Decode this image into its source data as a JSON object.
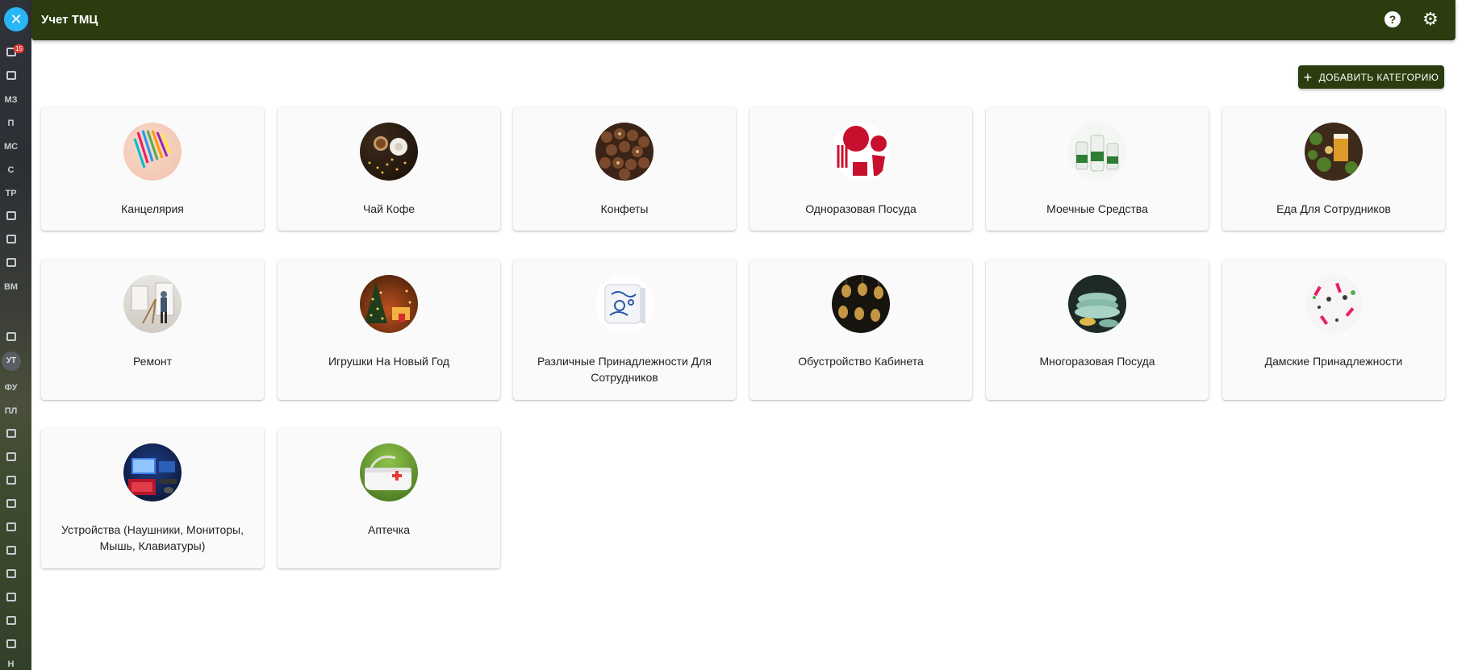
{
  "header": {
    "title": "Учет ТМЦ",
    "help_icon": "?",
    "settings_icon": "⚙"
  },
  "rail": {
    "close_icon": "✕",
    "badge_count": "15",
    "labels": [
      "МЗ",
      "П",
      "МС",
      "С",
      "ТР",
      "ВМ",
      "ФУ",
      "ПЛ",
      "Н"
    ],
    "avatar": "УТ"
  },
  "toolbar": {
    "add_category_label": "ДОБАВИТЬ КАТЕГОРИЮ",
    "add_icon": "+"
  },
  "colors": {
    "header": "#2b3d0f",
    "accent": "#29b6f6"
  },
  "categories": [
    {
      "label": "Канцелярия",
      "image": "stationery"
    },
    {
      "label": "Чай Кофе",
      "image": "tea-coffee"
    },
    {
      "label": "Конфеты",
      "image": "candies"
    },
    {
      "label": "Одноразовая Посуда",
      "image": "disposable-tableware"
    },
    {
      "label": "Моечные Средства",
      "image": "cleaning-products"
    },
    {
      "label": "Еда Для Сотрудников",
      "image": "employee-food"
    },
    {
      "label": "Ремонт",
      "image": "repair"
    },
    {
      "label": "Игрушки На Новый Год",
      "image": "new-year-toys"
    },
    {
      "label": "Различные Принадлежности Для Сотрудников",
      "image": "employee-accessories"
    },
    {
      "label": "Обустройство Кабинета",
      "image": "office-setup"
    },
    {
      "label": "Многоразовая Посуда",
      "image": "reusable-tableware"
    },
    {
      "label": "Дамские Принадлежности",
      "image": "ladies-accessories"
    },
    {
      "label": "Устройства (Наушники, Мониторы, Мышь, Клавиатуры)",
      "image": "devices"
    },
    {
      "label": "Аптечка",
      "image": "first-aid"
    }
  ]
}
